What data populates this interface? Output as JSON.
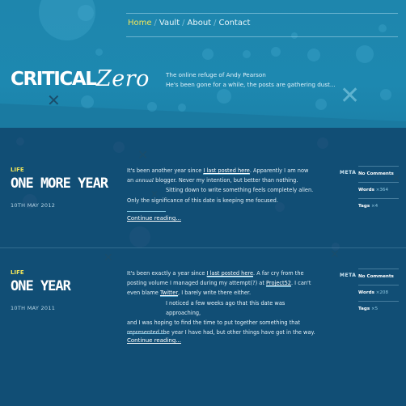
{
  "nav": {
    "items": [
      {
        "label": "Home",
        "active": true
      },
      {
        "label": "Vault",
        "active": false
      },
      {
        "label": "About",
        "active": false
      },
      {
        "label": "Contact",
        "active": false
      }
    ],
    "separator": "/"
  },
  "site": {
    "logo_text": "CRITICALZERO",
    "tagline_line1": "The online refuge of Andy Pearson",
    "tagline_line2": "He's been gone for a while, the posts are gathering dust..."
  },
  "meta_label": "META",
  "posts": [
    {
      "category": "LIFE",
      "title": "ONE MORE YEAR",
      "date": "10TH MAY 2012",
      "p1_a": "It's been another year since ",
      "p1_link": "I last posted here",
      "p1_b": ". Apparently I am now",
      "p1_c": "an ",
      "p1_it": "annual",
      "p1_d": " blogger. Never my intention, but better than nothing.",
      "p2": "Sitting down to write something feels completely alien.",
      "p3": "Only the significance of this date is keeping me focused.",
      "continue": "Continue reading...",
      "meta": {
        "comments": "No Comments",
        "words_label": "Words",
        "words": "364",
        "tags_label": "Tags",
        "tags": "4"
      }
    },
    {
      "category": "LIFE",
      "title": "ONE YEAR",
      "date": "10TH MAY 2011",
      "p1_a": "It's been exactly a year since ",
      "p1_link": "I last posted here",
      "p1_b": ". A far cry from the",
      "p1_c": "posting volume I managed during my attempt(?) at ",
      "p1_link2": "Project52",
      "p1_d": ". I can't",
      "p1_e": "even blame ",
      "p1_link3": "Twitter",
      "p1_f": ", I barely write there either.",
      "p2": "I noticed a few weeks ago that this date was approaching,",
      "p3": "and I was hoping to find the time to put together something that",
      "p4": "represented the year I have had, but other things have got in the way.",
      "continue": "Continue reading...",
      "meta": {
        "comments": "No Comments",
        "words_label": "Words",
        "words": "208",
        "tags_label": "Tags",
        "tags": "5"
      }
    }
  ]
}
